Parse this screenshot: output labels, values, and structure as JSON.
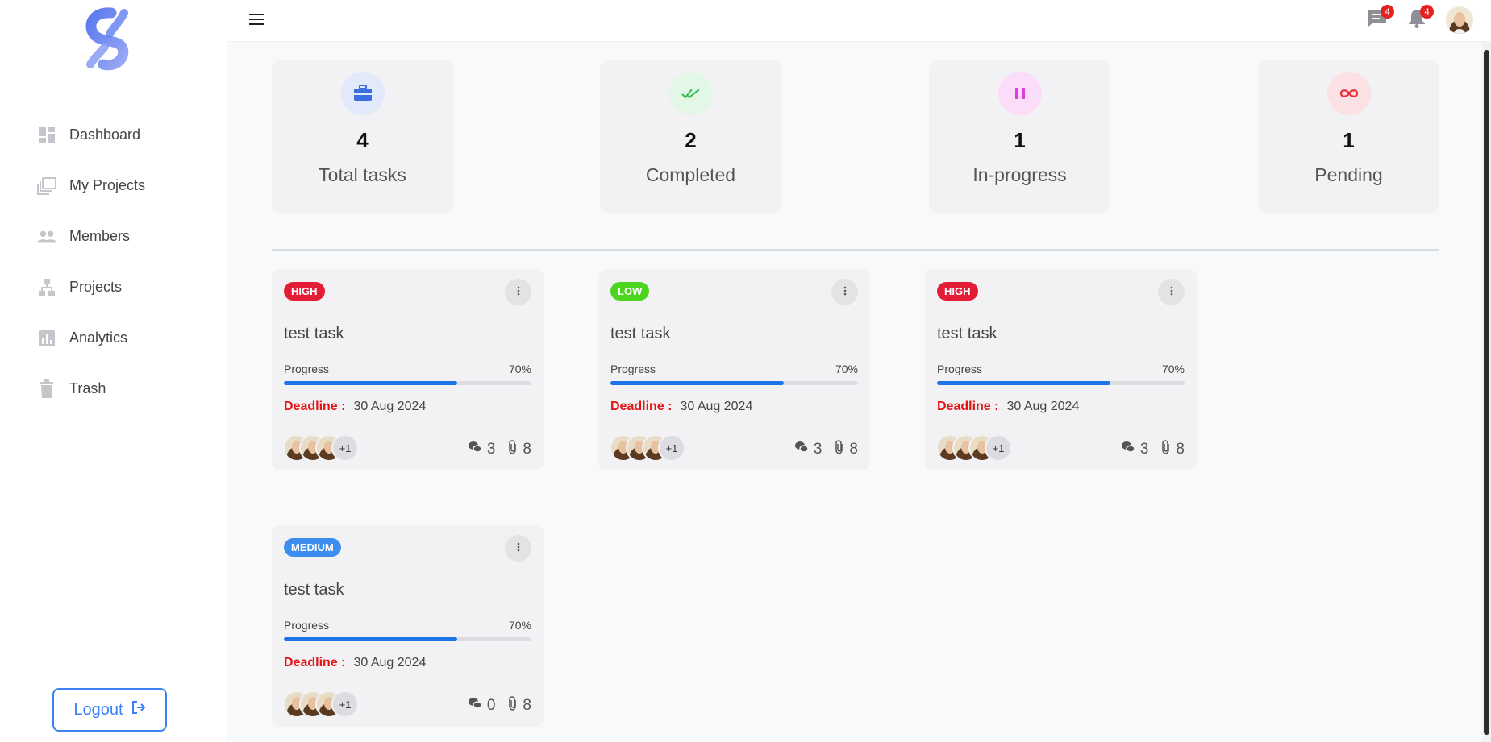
{
  "sidebar": {
    "items": [
      {
        "label": "Dashboard",
        "icon": "dashboard-icon"
      },
      {
        "label": "My Projects",
        "icon": "my-projects-icon"
      },
      {
        "label": "Members",
        "icon": "members-icon"
      },
      {
        "label": "Projects",
        "icon": "projects-icon"
      },
      {
        "label": "Analytics",
        "icon": "analytics-icon"
      },
      {
        "label": "Trash",
        "icon": "trash-icon"
      }
    ],
    "logout_label": "Logout"
  },
  "topbar": {
    "messages_count": "4",
    "notifications_count": "4"
  },
  "stats": [
    {
      "value": "4",
      "label": "Total tasks",
      "icon": "briefcase-icon",
      "icon_color": "#3b6fe0",
      "bg_color": "#e2e9fb"
    },
    {
      "value": "2",
      "label": "Completed",
      "icon": "double-check-icon",
      "icon_color": "#2ec04e",
      "bg_color": "#e3f7e6"
    },
    {
      "value": "1",
      "label": "In-progress",
      "icon": "pause-icon",
      "icon_color": "#e23adf",
      "bg_color": "#fbdcf9"
    },
    {
      "value": "1",
      "label": "Pending",
      "icon": "infinity-icon",
      "icon_color": "#ec2a3a",
      "bg_color": "#fbe1e3"
    }
  ],
  "tasks": [
    {
      "priority": "HIGH",
      "priority_color": "#e51c35",
      "title": "test task",
      "progress_label": "Progress",
      "progress_text": "70%",
      "progress": 0.7,
      "deadline_label": "Deadline :",
      "deadline": "30 Aug 2024",
      "extra_members": "+1",
      "comments": "3",
      "attachments": "8"
    },
    {
      "priority": "LOW",
      "priority_color": "#4cd41e",
      "title": "test task",
      "progress_label": "Progress",
      "progress_text": "70%",
      "progress": 0.7,
      "deadline_label": "Deadline :",
      "deadline": "30 Aug 2024",
      "extra_members": "+1",
      "comments": "3",
      "attachments": "8"
    },
    {
      "priority": "HIGH",
      "priority_color": "#e51c35",
      "title": "test task",
      "progress_label": "Progress",
      "progress_text": "70%",
      "progress": 0.7,
      "deadline_label": "Deadline :",
      "deadline": "30 Aug 2024",
      "extra_members": "+1",
      "comments": "3",
      "attachments": "8"
    },
    {
      "priority": "MEDIUM",
      "priority_color": "#3b8ef0",
      "title": "test task",
      "progress_label": "Progress",
      "progress_text": "70%",
      "progress": 0.7,
      "deadline_label": "Deadline :",
      "deadline": "30 Aug 2024",
      "extra_members": "+1",
      "comments": "0",
      "attachments": "8"
    }
  ]
}
